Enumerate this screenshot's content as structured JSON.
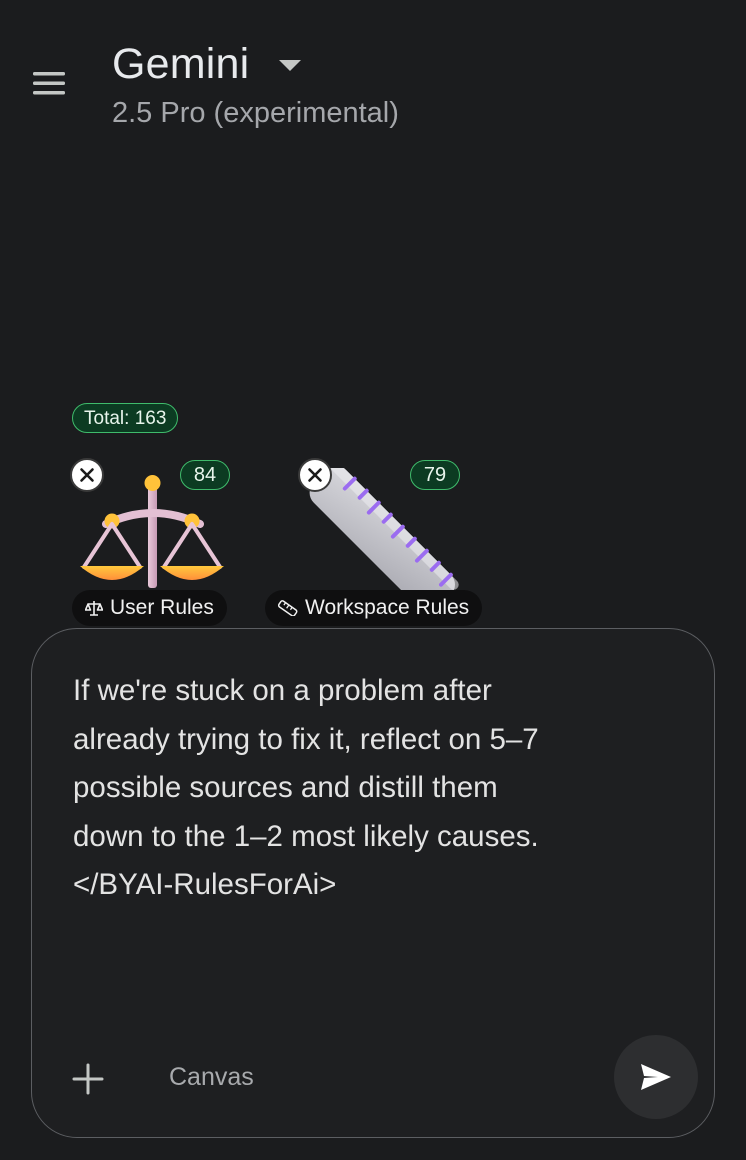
{
  "header": {
    "app_title": "Gemini",
    "model": "2.5 Pro (experimental)",
    "menu_icon": "hamburger-menu-icon",
    "caret_icon": "caret-down-icon"
  },
  "rules": {
    "total_label": "Total: 163",
    "cards": [
      {
        "name": "User Rules",
        "count": "84",
        "icon": "balance-scale-icon",
        "label_icon": "scale-icon"
      },
      {
        "name": "Workspace Rules",
        "count": "79",
        "icon": "ruler-icon",
        "label_icon": "ruler-small-icon"
      }
    ]
  },
  "composer": {
    "text": "If we're stuck on a problem after\nalready trying to fix it, reflect on 5–7\npossible sources and distill them\ndown to the 1–2 most likely causes.\n</BYAI-RulesForAi>",
    "canvas_label": "Canvas",
    "add_icon": "plus-icon",
    "send_icon": "send-icon"
  },
  "colors": {
    "background": "#1b1c1e",
    "badge_border": "#3fbb6b",
    "badge_fill": "#0c3b22",
    "ruler_tick": "#9b6cf0"
  }
}
